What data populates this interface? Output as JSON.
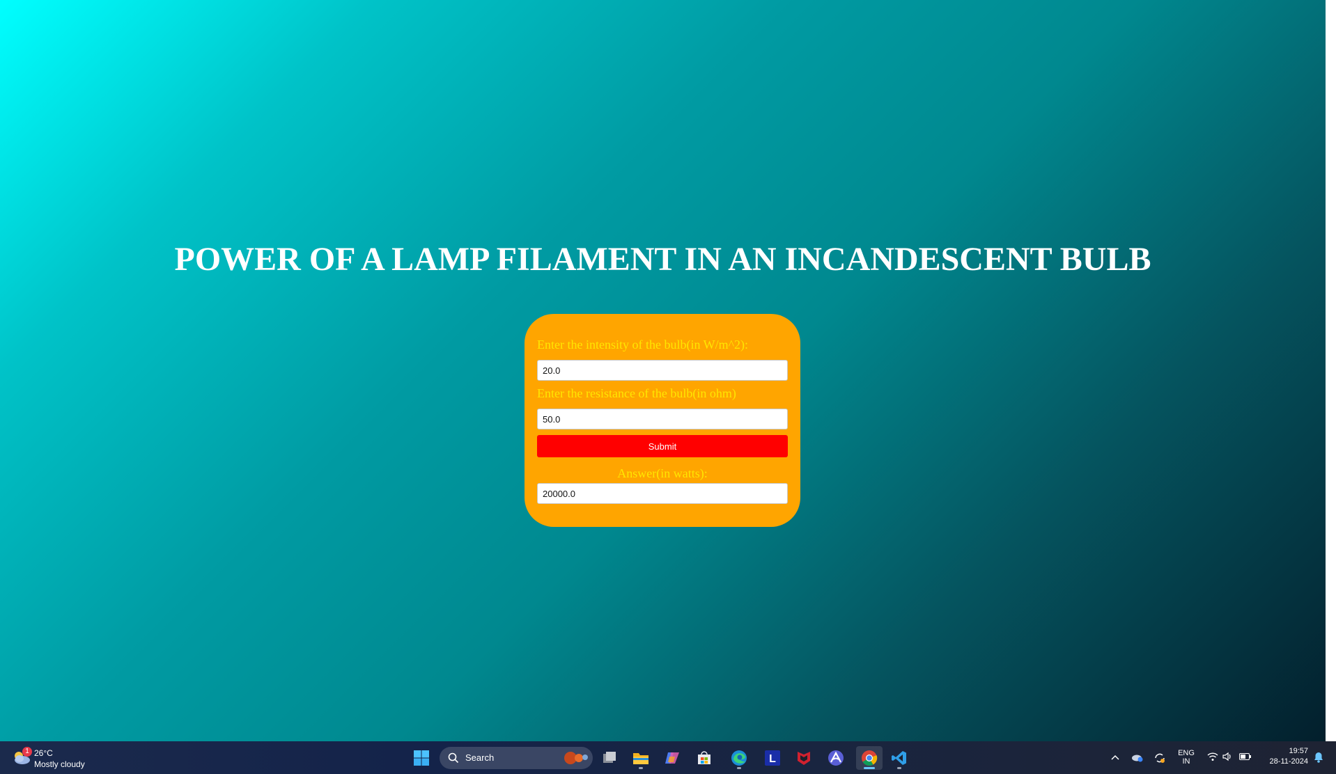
{
  "page": {
    "title": "POWER OF A LAMP FILAMENT IN AN INCANDESCENT BULB"
  },
  "form": {
    "intensity_label": "Enter the intensity of the bulb(in W/m^2):",
    "intensity_value": "20.0",
    "resistance_label": "Enter the resistance of the bulb(in ohm)",
    "resistance_value": "50.0",
    "submit_label": "Submit",
    "answer_label": "Answer(in watts):",
    "answer_value": "20000.0"
  },
  "colors": {
    "card": "#ffa500",
    "label_text": "#ffe600",
    "submit": "#ff0000",
    "title_text": "#ffffff"
  },
  "taskbar": {
    "weather": {
      "badge": "1",
      "temperature": "26°C",
      "condition": "Mostly cloudy"
    },
    "search_placeholder": "Search",
    "apps": [
      {
        "name": "start",
        "icon": "windows-icon"
      },
      {
        "name": "task-view",
        "icon": "task-view-icon"
      },
      {
        "name": "file-explorer",
        "icon": "folder-icon"
      },
      {
        "name": "copilot",
        "icon": "copilot-icon"
      },
      {
        "name": "microsoft-store",
        "icon": "store-icon"
      },
      {
        "name": "edge",
        "icon": "edge-icon"
      },
      {
        "name": "l-app",
        "icon": "l-app-icon",
        "letter": "L"
      },
      {
        "name": "mcafee",
        "icon": "mcafee-icon"
      },
      {
        "name": "arc-app",
        "icon": "arc-icon"
      },
      {
        "name": "chrome",
        "icon": "chrome-icon"
      },
      {
        "name": "vscode",
        "icon": "vscode-icon"
      }
    ],
    "tray": {
      "language": "ENG",
      "region": "IN",
      "time": "19:57",
      "date": "28-11-2024"
    }
  }
}
